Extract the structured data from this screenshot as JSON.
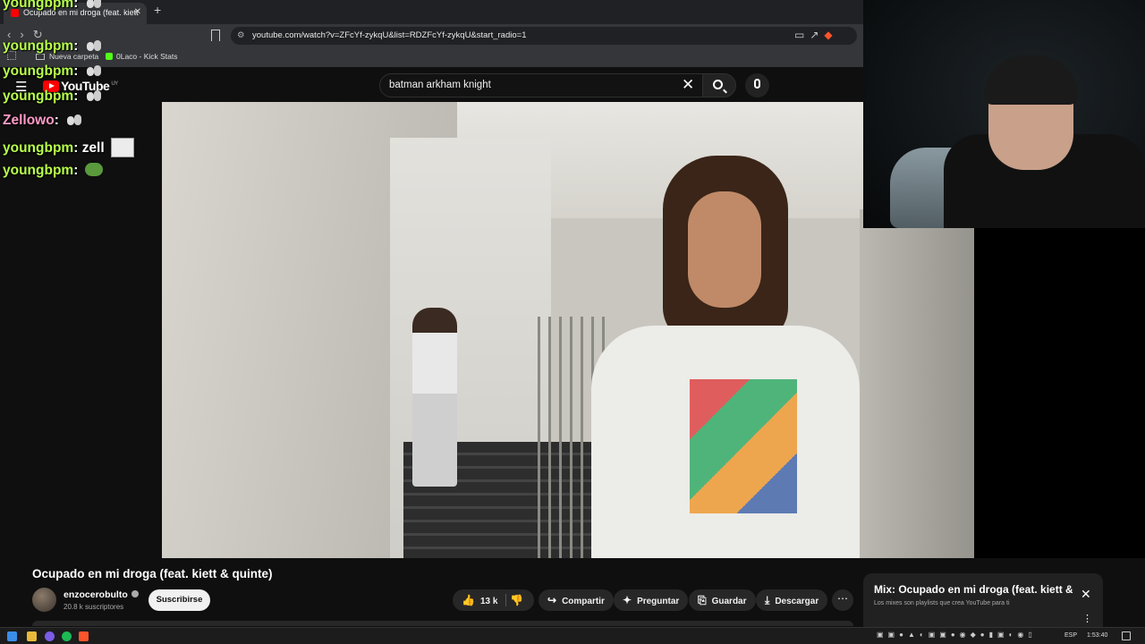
{
  "browser": {
    "tab_title": "Ocupado en mi droga (feat. kiett",
    "new_tab_symbol": "+",
    "url": "youtube.com/watch?v=ZFcYf-zykqU&list=RDZFcYf-zykqU&start_radio=1",
    "bookmarks": [
      "Nueva carpeta",
      "0Laco - Kick Stats"
    ]
  },
  "youtube": {
    "logo_text": "YouTube",
    "region": "UY",
    "search_value": "batman arkham knight"
  },
  "chat": [
    {
      "user": "youngbpm",
      "text": "",
      "emote": "cat"
    },
    {
      "user": "youngbpm",
      "text": "",
      "emote": "cat"
    },
    {
      "user": "youngbpm",
      "text": "",
      "emote": "cat"
    },
    {
      "user": "youngbpm",
      "text": "",
      "emote": "cat"
    },
    {
      "user": "Zellowo",
      "text": "",
      "emote": "cat"
    },
    {
      "user": "youngbpm",
      "text": "zell",
      "emote": "pic"
    },
    {
      "user": "youngbpm",
      "text": "",
      "emote": "frog"
    }
  ],
  "video": {
    "title": "Ocupado en mi droga (feat. kiett & quinte)",
    "channel": "enzocerobulto",
    "subscribers": "20.8 k suscriptores",
    "subscribe_label": "Suscribirse",
    "likes": "13 k",
    "share_label": "Compartir",
    "ask_label": "Preguntar",
    "save_label": "Guardar",
    "download_label": "Descargar"
  },
  "mix": {
    "title": "Mix: Ocupado en mi droga (feat. kiett & quinte)",
    "subtitle": "Los mixes son playlists que crea YouTube para ti"
  },
  "taskbar": {
    "language": "ESP",
    "time": "1:53:40"
  },
  "colors": {
    "chat_username": "#b7ff4a",
    "chat_username_alt": "#ff9ac8",
    "youtube_red": "#ff0000"
  }
}
